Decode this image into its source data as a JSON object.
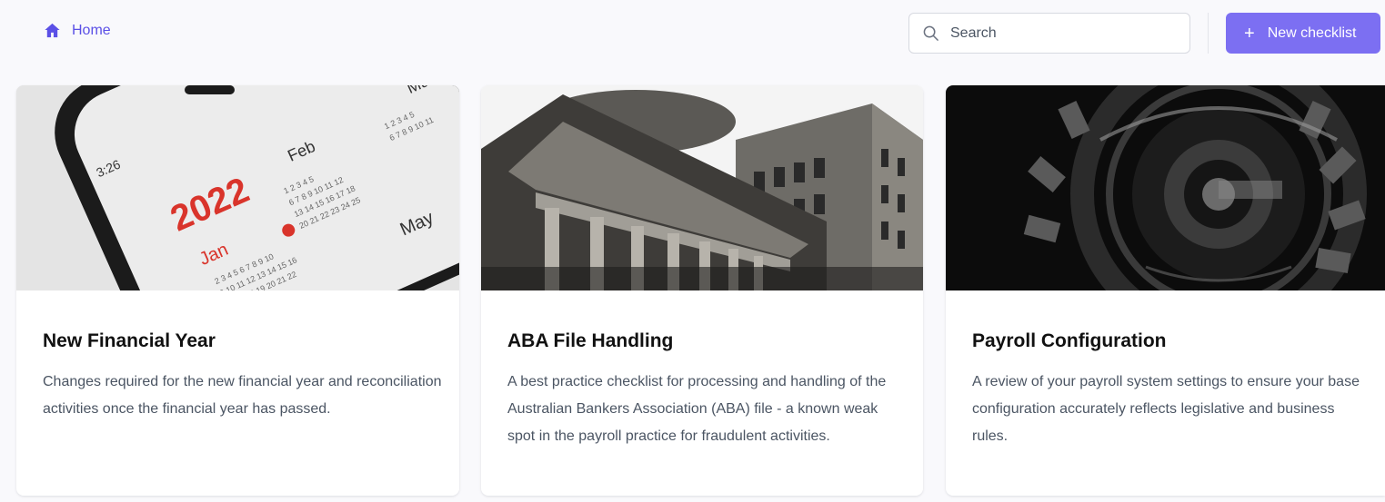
{
  "breadcrumb": {
    "home_label": "Home"
  },
  "search": {
    "placeholder": "Search"
  },
  "toolbar": {
    "new_checklist_label": "New checklist",
    "plus_symbol": "+"
  },
  "colors": {
    "accent": "#7c6ff2",
    "link": "#5b50e6",
    "background": "#f9f9fc"
  },
  "cards": [
    {
      "title": "New Financial Year",
      "description": "Changes required for the new financial year and reconciliation activities once the financial year has passed.",
      "image": {
        "kind": "phone-calendar-photo",
        "year": "2022",
        "time": "3:26",
        "months": [
          "Jan",
          "Feb",
          "Mar",
          "May"
        ]
      }
    },
    {
      "title": "ABA File Handling",
      "description": "A best practice checklist for processing and handling of the Australian Bankers Association (ABA) file - a known weak spot in the payroll practice for fraudulent activities.",
      "image": {
        "kind": "bank-building-photo"
      }
    },
    {
      "title": "Payroll Configuration",
      "description": "A review of your payroll system settings to ensure your base configuration accurately reflects legislative and business rules.",
      "image": {
        "kind": "gears-photo"
      }
    }
  ]
}
